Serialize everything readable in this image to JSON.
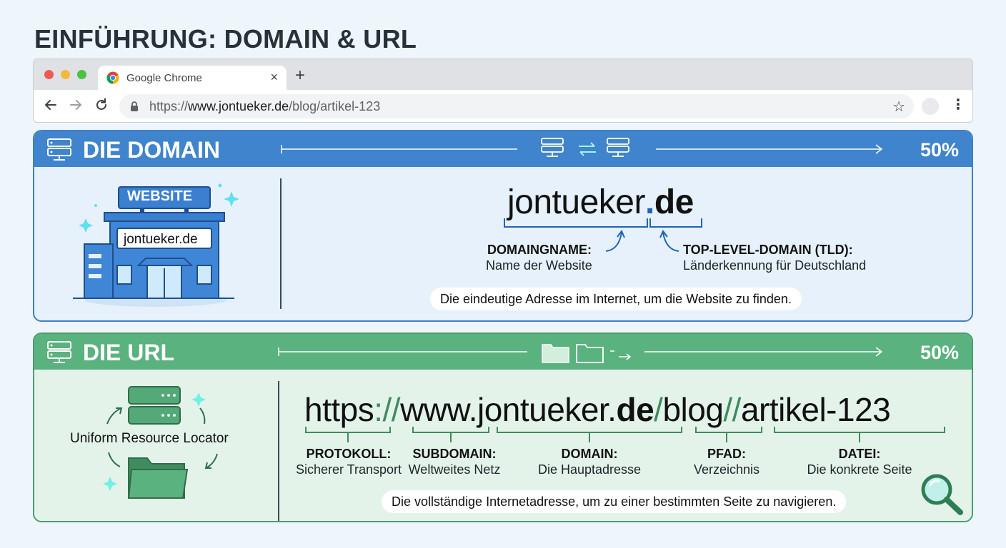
{
  "page": {
    "title": "EINFÜHRUNG: DOMAIN & URL"
  },
  "browser": {
    "tab_title": "Google Chrome",
    "tab_close": "×",
    "new_tab": "+",
    "url_scheme": "https://",
    "url_host": "www.jontueker.de",
    "url_path": "/blog/artikel-123",
    "star": "☆",
    "menu": "⋮"
  },
  "domain_panel": {
    "title": "DIE DOMAIN",
    "percent": "50%",
    "illustration": {
      "sign": "WEBSITE",
      "plaque": "jontueker.de"
    },
    "domain_name_part": "jontueker",
    "domain_dot": ".",
    "domain_tld_part": "de",
    "domainname": {
      "label": "DOMAINGNAME:",
      "desc": "Name der Website"
    },
    "tld": {
      "label": "TOP-LEVEL-DOMAIN (TLD):",
      "desc": "Länderkennung für Deutschland"
    },
    "caption": "Die eindeutige Adresse im Internet, um die Website zu finden.",
    "accent": "#3f84cc"
  },
  "url_panel": {
    "title": "DIE URL",
    "percent": "50%",
    "illustration_label": "Uniform Resource Locator",
    "url_parts": {
      "protocol": "https",
      "sep1": "://",
      "subdomain": "www.",
      "domain_name": "jontueker.",
      "domain_tld": "de",
      "sep2": "/",
      "path": "blog",
      "sep3": "//",
      "file": "artikel-123"
    },
    "parts": [
      {
        "label": "PROTOKOLL:",
        "desc": "Sicherer Transport"
      },
      {
        "label": "SUBDOMAIN:",
        "desc": "Weltweites Netz"
      },
      {
        "label": "DOMAIN:",
        "desc": "Die Hauptadresse"
      },
      {
        "label": "PFAD:",
        "desc": "Verzeichnis"
      },
      {
        "label": "DATEI:",
        "desc": "Die konkrete Seite"
      }
    ],
    "caption": "Die vollständige Internetadresse, um zu einer bestimmten Seite zu navigieren.",
    "accent": "#5ab27f"
  },
  "icons": [
    "server-icon",
    "swap-arrows-icon",
    "folder-icon",
    "building-icon",
    "magnifier-icon",
    "lock-icon",
    "star-icon",
    "chrome-logo-icon"
  ]
}
